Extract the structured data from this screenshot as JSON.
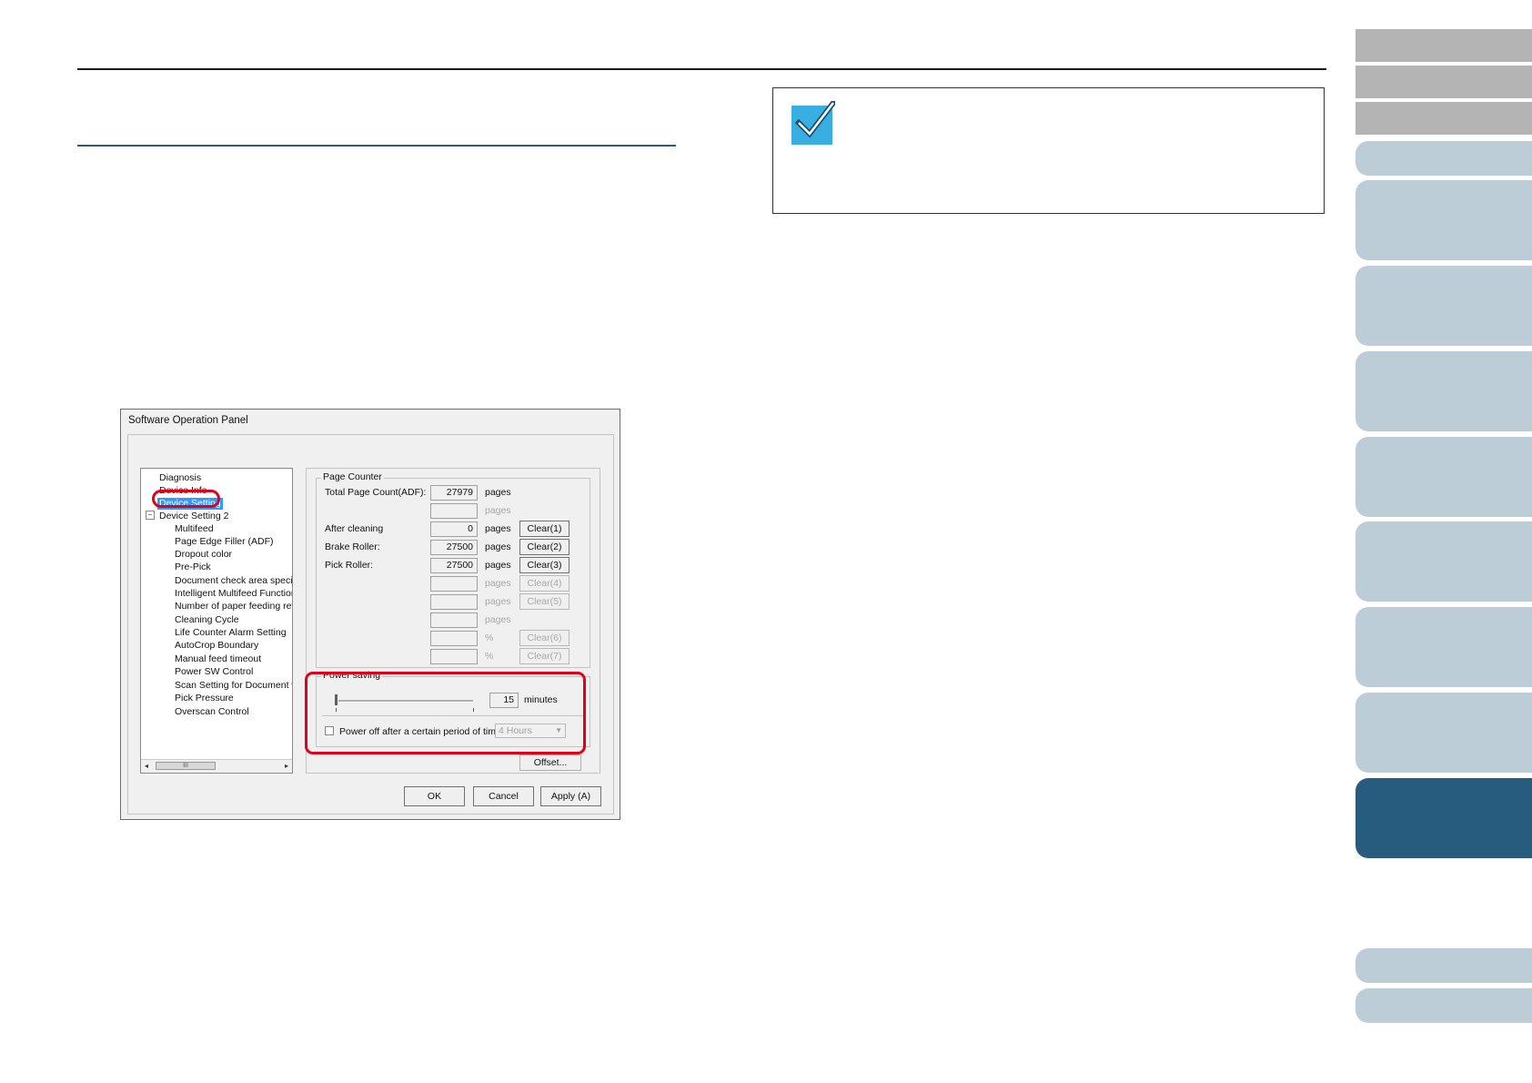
{
  "dialog": {
    "title": "Software Operation Panel",
    "tree": {
      "items": [
        "Diagnosis",
        "Device Info",
        "Device Setting",
        "Device Setting 2",
        "Multifeed",
        "Page Edge Filler (ADF)",
        "Dropout color",
        "Pre-Pick",
        "Document check area specific",
        "Intelligent Multifeed Function",
        "Number of paper feeding retrie",
        "Cleaning Cycle",
        "Life Counter Alarm Setting",
        "AutoCrop Boundary",
        "Manual feed timeout",
        "Power SW Control",
        "Scan Setting for Document wit",
        "Pick Pressure",
        "Overscan Control"
      ],
      "expander": "−",
      "scroll_thumb": "III",
      "scroll_left": "◂",
      "scroll_right": "▸"
    },
    "page_counter": {
      "group_label": "Page Counter",
      "rows": [
        {
          "label": "Total Page Count(ADF):",
          "value": "27979",
          "unit": "pages",
          "button": "",
          "enabled": true
        },
        {
          "label": "",
          "value": "",
          "unit": "pages",
          "button": "",
          "enabled": false
        },
        {
          "label": "After cleaning",
          "value": "0",
          "unit": "pages",
          "button": "Clear(1)",
          "enabled": true
        },
        {
          "label": "Brake Roller:",
          "value": "27500",
          "unit": "pages",
          "button": "Clear(2)",
          "enabled": true
        },
        {
          "label": "Pick Roller:",
          "value": "27500",
          "unit": "pages",
          "button": "Clear(3)",
          "enabled": true
        },
        {
          "label": "",
          "value": "",
          "unit": "pages",
          "button": "Clear(4)",
          "enabled": false
        },
        {
          "label": "",
          "value": "",
          "unit": "pages",
          "button": "Clear(5)",
          "enabled": false
        },
        {
          "label": "",
          "value": "",
          "unit": "pages",
          "button": "",
          "enabled": false
        },
        {
          "label": "",
          "value": "",
          "unit": "%",
          "button": "Clear(6)",
          "enabled": false
        },
        {
          "label": "",
          "value": "",
          "unit": "%",
          "button": "Clear(7)",
          "enabled": false
        }
      ]
    },
    "power_saving": {
      "group_label": "Power saving",
      "minutes_value": "15",
      "minutes_unit": "minutes",
      "power_off_label": "Power off after a certain period of time",
      "power_off_checked": false,
      "hours_value": "4 Hours",
      "combo_arrow": "▼"
    },
    "offset_button": "Offset...",
    "ok_button": "OK",
    "cancel_button": "Cancel",
    "apply_button": "Apply (A)"
  },
  "colors": {
    "highlight": "#e0001a",
    "tab_light": "#bccdd8",
    "tab_dark": "#285c7e",
    "tab_gray": "#b4b4b4",
    "note_icon": "#39aee0"
  }
}
